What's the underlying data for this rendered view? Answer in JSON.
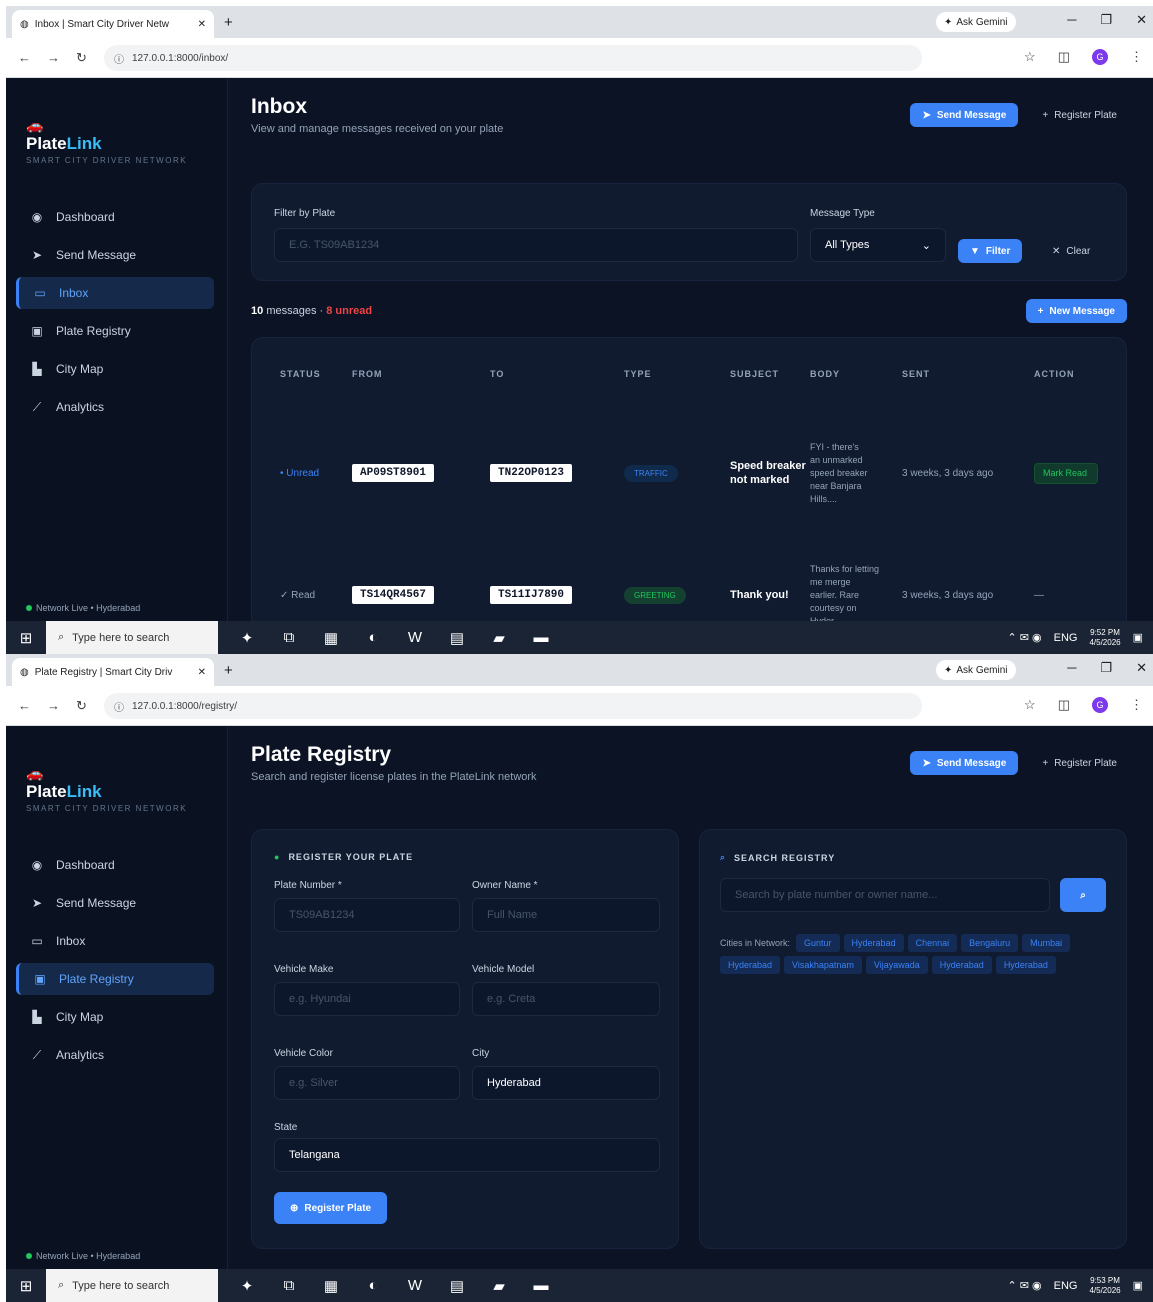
{
  "screen1": {
    "tab_title": "Inbox | Smart City Driver Netw",
    "url": "127.0.0.1:8000/inbox/",
    "page_title": "Inbox",
    "page_subtitle": "View and manage messages received on your plate",
    "filter": {
      "plate_label": "Filter by Plate",
      "plate_placeholder": "E.G. TS09AB1234",
      "type_label": "Message Type",
      "type_value": "All Types",
      "filter_button": "Filter",
      "clear_button": "Clear"
    },
    "count_number": "10",
    "count_text": "messages ·",
    "unread_text": "8 unread",
    "new_message_button": "New Message",
    "table": {
      "headers": [
        "STATUS",
        "FROM",
        "TO",
        "TYPE",
        "SUBJECT",
        "BODY",
        "SENT",
        "ACTION"
      ],
      "rows": [
        {
          "status": "• Unread",
          "from": "AP09ST8901",
          "to": "TN22OP0123",
          "type": "TRAFFIC",
          "subject": "Speed breaker not marked",
          "body": "FYI - there's an unmarked speed breaker near Banjara Hills....",
          "sent": "3 weeks, 3 days ago",
          "action": "Mark Read"
        },
        {
          "status": "✓ Read",
          "from": "TS14QR4567",
          "to": "TS11IJ7890",
          "type": "GREETING",
          "subject": "Thank you!",
          "body": "Thanks for letting me merge earlier. Rare courtesy on Hyder....",
          "sent": "3 weeks, 3 days ago",
          "action": "—"
        }
      ]
    },
    "clock_time": "9:52 PM",
    "clock_date": "4/5/2026"
  },
  "screen2": {
    "tab_title": "Plate Registry | Smart City Driv",
    "url": "127.0.0.1:8000/registry/",
    "page_title": "Plate Registry",
    "page_subtitle": "Search and register license plates in the PlateLink network",
    "register": {
      "heading": "REGISTER YOUR PLATE",
      "plate_label": "Plate Number *",
      "plate_placeholder": "TS09AB1234",
      "owner_label": "Owner Name *",
      "owner_placeholder": "Full Name",
      "make_label": "Vehicle Make",
      "make_placeholder": "e.g. Hyundai",
      "model_label": "Vehicle Model",
      "model_placeholder": "e.g. Creta",
      "color_label": "Vehicle Color",
      "color_placeholder": "e.g. Silver",
      "city_label": "City",
      "city_value": "Hyderabad",
      "state_label": "State",
      "state_value": "Telangana",
      "submit_button": "Register Plate"
    },
    "search": {
      "heading": "SEARCH REGISTRY",
      "placeholder": "Search by plate number or owner name...",
      "cities_label": "Cities in Network:",
      "cities": [
        "Guntur",
        "Hyderabad",
        "Chennai",
        "Bengaluru",
        "Mumbai",
        "Hyderabad",
        "Visakhapatnam",
        "Vijayawada",
        "Hyderabad",
        "Hyderabad"
      ]
    },
    "clock_time": "9:53 PM",
    "clock_date": "4/5/2026"
  },
  "common": {
    "ask_gemini": "Ask Gemini",
    "brand_a": "Plate",
    "brand_b": "Link",
    "brand_tagline": "SMART CITY DRIVER NETWORK",
    "nav": [
      "Dashboard",
      "Send Message",
      "Inbox",
      "Plate Registry",
      "City Map",
      "Analytics"
    ],
    "network_status": "Network Live • Hyderabad",
    "send_message_button": "Send Message",
    "register_plate_button": "Register Plate",
    "taskbar_search": "Type here to search",
    "tray_lang": "ENG"
  },
  "colors": {
    "accent": "#3b82f6",
    "unread": "#ef4444",
    "success": "#22c55e",
    "bg": "#0b1324"
  }
}
